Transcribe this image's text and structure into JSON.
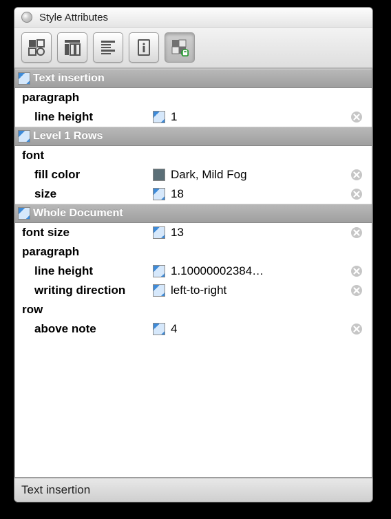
{
  "window": {
    "title": "Style Attributes"
  },
  "footer": {
    "text": "Text insertion"
  },
  "sections": [
    {
      "title": "Text insertion",
      "groups": [
        {
          "label": "paragraph",
          "attrs": [
            {
              "name": "line height",
              "swatch": "blue",
              "value": "1"
            }
          ]
        }
      ]
    },
    {
      "title": "Level 1 Rows",
      "groups": [
        {
          "label": "font",
          "attrs": [
            {
              "name": "fill color",
              "swatch": "color",
              "color": "#5b6f77",
              "value": "Dark, Mild Fog"
            },
            {
              "name": "size",
              "swatch": "blue",
              "value": "18"
            }
          ]
        }
      ]
    },
    {
      "title": "Whole Document",
      "groups": [
        {
          "label": "font size",
          "inline": true,
          "attrs": [
            {
              "name": "font size",
              "swatch": "blue",
              "value": "13"
            }
          ]
        },
        {
          "label": "paragraph",
          "attrs": [
            {
              "name": "line height",
              "swatch": "blue",
              "value": "1.10000002384…"
            },
            {
              "name": "writing direction",
              "swatch": "blue",
              "value": "left-to-right"
            }
          ]
        },
        {
          "label": "row",
          "attrs": [
            {
              "name": "above note",
              "swatch": "blue",
              "value": "4"
            }
          ]
        }
      ]
    }
  ]
}
